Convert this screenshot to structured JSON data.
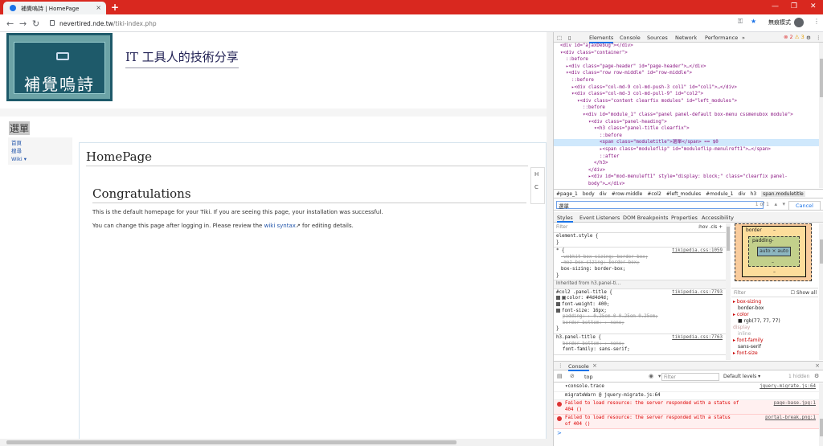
{
  "browser": {
    "tab_title": "補覺嗚詩 | HomePage",
    "tab_close": "×",
    "new_tab": "+",
    "url_host": "nevertired.nde.tw",
    "url_path": "/tiki-index.php",
    "incognito_label": "無痕模式",
    "back": "←",
    "forward": "→",
    "reload": "↻",
    "minimize": "—",
    "maximize": "❐",
    "close": "✕",
    "key_icon": "⚿",
    "star_icon": "★",
    "menu_icon": "⋮"
  },
  "site": {
    "logo_text": "補覺嗚詩",
    "title": "IT 工具人的技術分享",
    "module_title": "選單",
    "module_links": [
      "首頁",
      "搜尋",
      "Wiki ▾"
    ],
    "page_heading": "HomePage",
    "section_heading": "Congratulations",
    "para1": "This is the default homepage for your Tiki. If you are seeing this page, your installation was successful.",
    "para2_pre": "You can change this page after logging in. Please review the ",
    "para2_link": "wiki syntax",
    "para2_post": " for editing details.",
    "flip_letters": "H\n\nC"
  },
  "devtools": {
    "tabs": [
      "Elements",
      "Console",
      "Sources",
      "Network",
      "Performance",
      "»"
    ],
    "errors": "⊗ 2",
    "warnings": "⚠ 3",
    "dom": [
      {
        "t": "<div id=\"ajaxDebug\"></div>",
        "i": 0
      },
      {
        "t": "▾<div class=\"container\">",
        "i": 0
      },
      {
        "t": "::before",
        "i": 1
      },
      {
        "t": "▸<div class=\"page-header\" id=\"page-header\">…</div>",
        "i": 1
      },
      {
        "t": "▾<div class=\"row row-middle\" id=\"row-middle\">",
        "i": 1
      },
      {
        "t": "::before",
        "i": 2
      },
      {
        "t": "▸<div class=\"col-md-9 col-md-push-3 col1\" id=\"col1\">…</div>",
        "i": 2
      },
      {
        "t": "▾<div class=\"col-md-3 col-md-pull-9\" id=\"col2\">",
        "i": 2
      },
      {
        "t": "▾<div class=\"content clearfix modules\" id=\"left_modules\">",
        "i": 3
      },
      {
        "t": "::before",
        "i": 4
      },
      {
        "t": "▾<div id=\"module_1\" class=\"panel panel-default box-menu cssmenubox module\">",
        "i": 4
      },
      {
        "t": "▾<div class=\"panel-heading\">",
        "i": 5
      },
      {
        "t": "▾<h3 class=\"panel-title clearfix\">",
        "i": 6
      },
      {
        "t": "::before",
        "i": 7
      },
      {
        "t": "<span class=\"moduletitle\">選單</span> == $0",
        "i": 7,
        "sel": true
      },
      {
        "t": "▸<span class=\"moduleflip\" id=\"moduleflip-menulreft1\">…</span>",
        "i": 7
      },
      {
        "t": "::after",
        "i": 7
      },
      {
        "t": "</h3>",
        "i": 6
      },
      {
        "t": "</div>",
        "i": 5
      },
      {
        "t": "▸<div id=\"mod-menuleft1\" style=\"display: block;\" class=\"clearfix panel-",
        "i": 5
      },
      {
        "t": "body\">…</div>",
        "i": 5
      }
    ],
    "breadcrumbs": [
      "#page_1",
      "body",
      "div",
      "#row-middle",
      "#col2",
      "#left_modules",
      "#module_1",
      "div",
      "h3",
      "span.moduletitle"
    ],
    "find_value": "選單",
    "find_count": "1 of 1",
    "find_cancel": "Cancel",
    "sub_tabs": [
      "Styles",
      "Event Listeners",
      "DOM Breakpoints",
      "Properties",
      "Accessibility"
    ],
    "styles_filter": "Filter",
    "styles_hov": ":hov .cls +",
    "element_style": "element.style {",
    "close_brace": "}",
    "rule1_selector": "* {",
    "rule1_src": "tikipedia.css:1059",
    "rule1_p1": "-webkit-box-sizing: border-box;",
    "rule1_p2": "-moz-box-sizing: border-box;",
    "rule1_p3": "box-sizing: border-box;",
    "inherited": "Inherited from h3.panel-ti…",
    "rule2_selector": "#col2 .panel-title {",
    "rule2_src": "tikipedia.css:7793",
    "rule2_p1": "color: #4d4d4d;",
    "rule2_p2": "font-weight: 400;",
    "rule2_p3": "font-size: 16px;",
    "rule2_p4": "padding: ▸ 0.25em 0 0.25em 0.25em;",
    "rule2_p5": "border-bottom: ▸ none;",
    "rule3_selector": "h3.panel-title {",
    "rule3_src": "tikipedia.css:7763",
    "rule3_p1": "border-bottom: ▸ none;",
    "rule3_p2": "font-family: sans-serif;",
    "box_border": "border",
    "box_padding": "padding-",
    "box_content": "auto × auto",
    "box_dash": "–",
    "computed_filter": "Filter",
    "show_all": "Show all",
    "computed": [
      {
        "k": "▸ box-sizing",
        "v": "border-box"
      },
      {
        "k": "▸ color",
        "v": "■ rgb(77, 77, 77)"
      },
      {
        "k": "display",
        "v": "inline",
        "dim": true
      },
      {
        "k": "▸ font-family",
        "v": "sans-serif"
      },
      {
        "k": "▸ font-size",
        "v": ""
      }
    ],
    "drawer_tab": "Console",
    "drawer_close": "×",
    "context": "top",
    "console_filter": "Filter",
    "levels": "Default levels ▾",
    "hidden": "1 hidden",
    "console": [
      {
        "t": "▾console.trace",
        "src": "jquery-migrate.js:64",
        "err": false
      },
      {
        "t": "migrateWarn @ jquery-migrate.js:64",
        "src": "",
        "err": false
      },
      {
        "t": "Failed to load resource: the server responded with a status of",
        "t2": "404 ()",
        "src": "page-base.jpg:1",
        "err": true
      },
      {
        "t": "Failed to load resource: the server responded with a status",
        "t2": "of 404 ()",
        "src": "portal-break.png:1",
        "err": true
      }
    ],
    "prompt": ">"
  },
  "colors": {
    "titlebar": "#d9281f",
    "accent": "#1a73e8",
    "logo_bg": "#1e5a6a"
  }
}
